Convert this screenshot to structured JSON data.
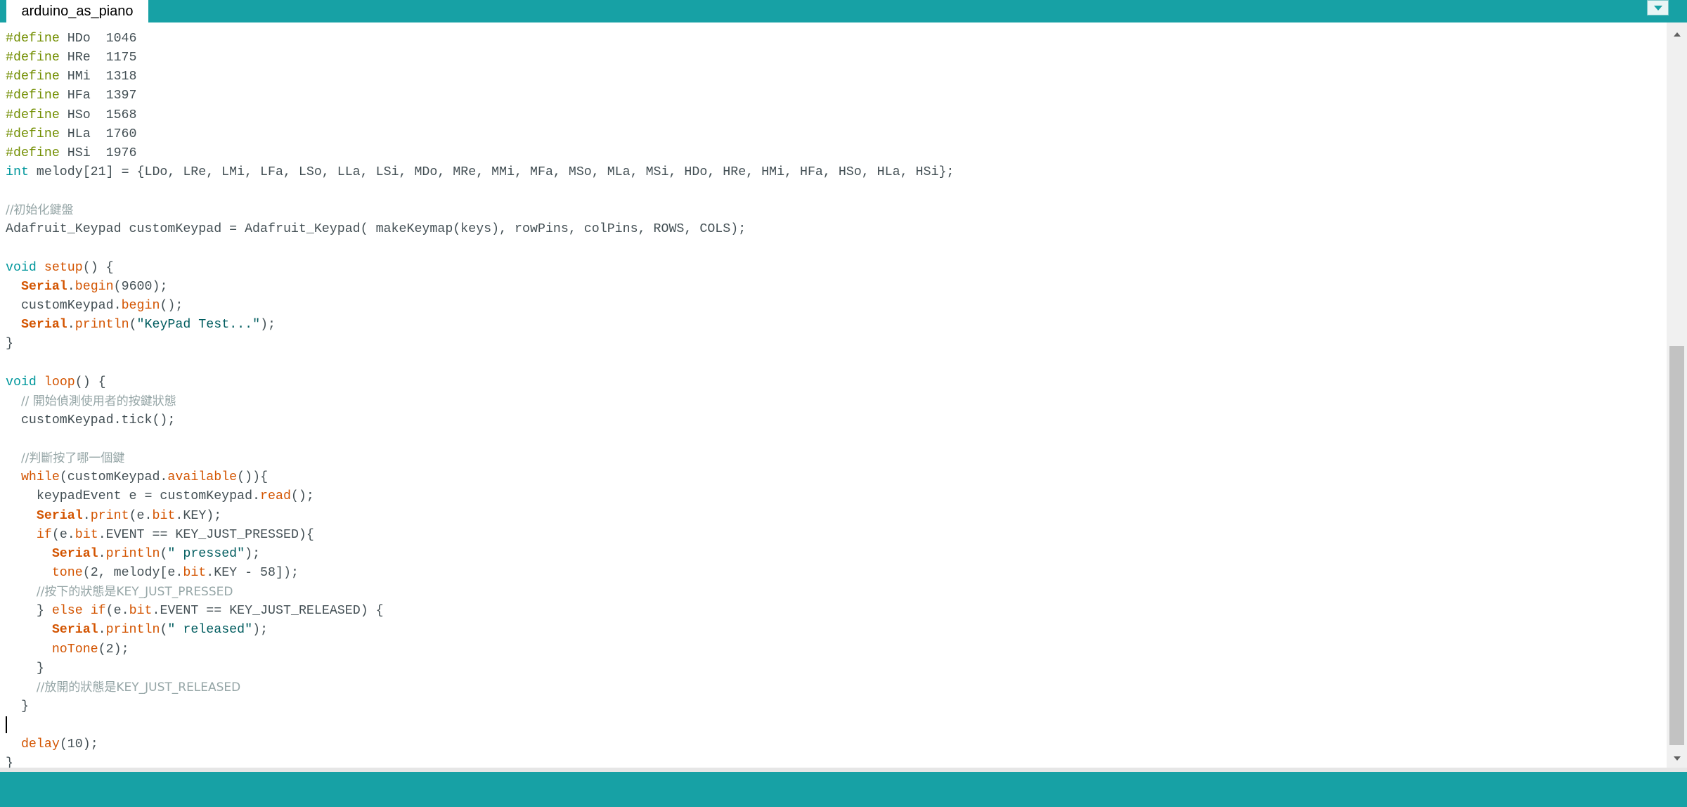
{
  "tabs": [
    {
      "label": "arduino_as_piano",
      "active": true
    }
  ],
  "icons": {
    "tab_menu": "chevron-down-icon",
    "scroll_up": "triangle-up-icon",
    "scroll_down": "triangle-down-icon"
  },
  "colors": {
    "accent": "#17a1a5",
    "keyword": "#00979c",
    "preprocessor": "#728e00",
    "function": "#d35400",
    "comment": "#95a5a6",
    "string": "#005c5f",
    "text": "#434f54"
  },
  "editor": {
    "lines": [
      [
        {
          "t": "#define",
          "c": "pre"
        },
        {
          "t": " HDo  1046"
        }
      ],
      [
        {
          "t": "#define",
          "c": "pre"
        },
        {
          "t": " HRe  1175"
        }
      ],
      [
        {
          "t": "#define",
          "c": "pre"
        },
        {
          "t": " HMi  1318"
        }
      ],
      [
        {
          "t": "#define",
          "c": "pre"
        },
        {
          "t": " HFa  1397"
        }
      ],
      [
        {
          "t": "#define",
          "c": "pre"
        },
        {
          "t": " HSo  1568"
        }
      ],
      [
        {
          "t": "#define",
          "c": "pre"
        },
        {
          "t": " HLa  1760"
        }
      ],
      [
        {
          "t": "#define",
          "c": "pre"
        },
        {
          "t": " HSi  1976"
        }
      ],
      [
        {
          "t": "int",
          "c": "kw"
        },
        {
          "t": " melody[21] = {LDo, LRe, LMi, LFa, LSo, LLa, LSi, MDo, MRe, MMi, MFa, MSo, MLa, MSi, HDo, HRe, HMi, HFa, HSo, HLa, HSi};"
        }
      ],
      [],
      [
        {
          "t": "//初始化鍵盤",
          "c": "cm"
        }
      ],
      [
        {
          "t": "Adafruit_Keypad customKeypad = Adafruit_Keypad( makeKeymap(keys), rowPins, colPins, ROWS, COLS);"
        }
      ],
      [],
      [
        {
          "t": "void",
          "c": "kw"
        },
        {
          "t": " "
        },
        {
          "t": "setup",
          "c": "fn"
        },
        {
          "t": "() {"
        }
      ],
      [
        {
          "t": "  "
        },
        {
          "t": "Serial",
          "c": "cls"
        },
        {
          "t": "."
        },
        {
          "t": "begin",
          "c": "fn"
        },
        {
          "t": "(9600);"
        }
      ],
      [
        {
          "t": "  customKeypad."
        },
        {
          "t": "begin",
          "c": "fn"
        },
        {
          "t": "();"
        }
      ],
      [
        {
          "t": "  "
        },
        {
          "t": "Serial",
          "c": "cls"
        },
        {
          "t": "."
        },
        {
          "t": "println",
          "c": "fn"
        },
        {
          "t": "("
        },
        {
          "t": "\"KeyPad Test...\"",
          "c": "str"
        },
        {
          "t": ");"
        }
      ],
      [
        {
          "t": "}"
        }
      ],
      [],
      [
        {
          "t": "void",
          "c": "kw"
        },
        {
          "t": " "
        },
        {
          "t": "loop",
          "c": "fn"
        },
        {
          "t": "() {"
        }
      ],
      [
        {
          "t": "  "
        },
        {
          "t": "// 開始偵測使用者的按鍵狀態",
          "c": "cm"
        }
      ],
      [
        {
          "t": "  customKeypad.tick();"
        }
      ],
      [],
      [
        {
          "t": "  "
        },
        {
          "t": "//判斷按了哪一個鍵",
          "c": "cm"
        }
      ],
      [
        {
          "t": "  "
        },
        {
          "t": "while",
          "c": "fn"
        },
        {
          "t": "(customKeypad."
        },
        {
          "t": "available",
          "c": "fn"
        },
        {
          "t": "()){"
        }
      ],
      [
        {
          "t": "    keypadEvent e = customKeypad."
        },
        {
          "t": "read",
          "c": "fn"
        },
        {
          "t": "();"
        }
      ],
      [
        {
          "t": "    "
        },
        {
          "t": "Serial",
          "c": "cls"
        },
        {
          "t": "."
        },
        {
          "t": "print",
          "c": "fn"
        },
        {
          "t": "(e."
        },
        {
          "t": "bit",
          "c": "fn"
        },
        {
          "t": ".KEY);"
        }
      ],
      [
        {
          "t": "    "
        },
        {
          "t": "if",
          "c": "fn"
        },
        {
          "t": "(e."
        },
        {
          "t": "bit",
          "c": "fn"
        },
        {
          "t": ".EVENT == KEY_JUST_PRESSED){"
        }
      ],
      [
        {
          "t": "      "
        },
        {
          "t": "Serial",
          "c": "cls"
        },
        {
          "t": "."
        },
        {
          "t": "println",
          "c": "fn"
        },
        {
          "t": "("
        },
        {
          "t": "\" pressed\"",
          "c": "str"
        },
        {
          "t": ");"
        }
      ],
      [
        {
          "t": "      "
        },
        {
          "t": "tone",
          "c": "fn"
        },
        {
          "t": "(2, melody[e."
        },
        {
          "t": "bit",
          "c": "fn"
        },
        {
          "t": ".KEY - 58]);"
        }
      ],
      [
        {
          "t": "    "
        },
        {
          "t": "//按下的狀態是KEY_JUST_PRESSED",
          "c": "cm"
        }
      ],
      [
        {
          "t": "    } "
        },
        {
          "t": "else",
          "c": "fn"
        },
        {
          "t": " "
        },
        {
          "t": "if",
          "c": "fn"
        },
        {
          "t": "(e."
        },
        {
          "t": "bit",
          "c": "fn"
        },
        {
          "t": ".EVENT == KEY_JUST_RELEASED) {"
        }
      ],
      [
        {
          "t": "      "
        },
        {
          "t": "Serial",
          "c": "cls"
        },
        {
          "t": "."
        },
        {
          "t": "println",
          "c": "fn"
        },
        {
          "t": "("
        },
        {
          "t": "\" released\"",
          "c": "str"
        },
        {
          "t": ");"
        }
      ],
      [
        {
          "t": "      "
        },
        {
          "t": "noTone",
          "c": "fn"
        },
        {
          "t": "(2);"
        }
      ],
      [
        {
          "t": "    }"
        }
      ],
      [
        {
          "t": "    "
        },
        {
          "t": "//放開的狀態是KEY_JUST_RELEASED",
          "c": "cm"
        }
      ],
      [
        {
          "t": "  }"
        }
      ],
      [
        {
          "caret": true
        }
      ],
      [
        {
          "t": "  "
        },
        {
          "t": "delay",
          "c": "fn"
        },
        {
          "t": "(10);"
        }
      ],
      [
        {
          "t": "}"
        }
      ]
    ]
  }
}
